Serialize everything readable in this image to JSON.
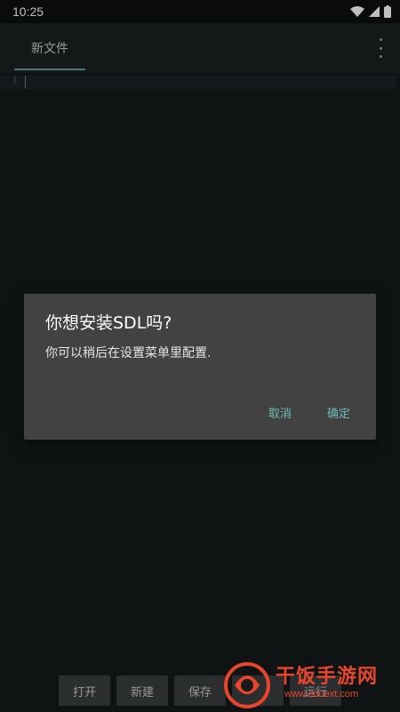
{
  "status_bar": {
    "time": "10:25",
    "icons": [
      "wifi-icon",
      "signal-icon",
      "battery-icon"
    ]
  },
  "tabs": [
    {
      "label": "新文件",
      "active": true
    }
  ],
  "menu_icon": "more-vertical-icon",
  "editor": {
    "line_numbers": [
      "1"
    ],
    "content": ""
  },
  "dialog": {
    "title": "你想安装SDL吗?",
    "message": "你可以稍后在设置菜单里配置.",
    "cancel_label": "取消",
    "ok_label": "确定"
  },
  "toolbar": {
    "buttons": [
      "打开",
      "新建",
      "保存",
      "",
      "运行"
    ]
  },
  "watermark": {
    "text": "干饭手游网",
    "url": "www.eduext.com"
  },
  "colors": {
    "accent": "#5fa6a4",
    "dialog_button": "#6fbab4",
    "watermark": "#e8462c"
  }
}
